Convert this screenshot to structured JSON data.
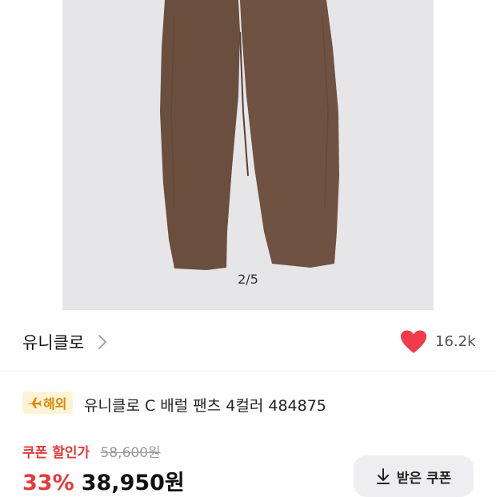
{
  "image": {
    "counter": "2/5",
    "product_color": "#6b4f3e",
    "background": "#e6e6e8"
  },
  "brand": {
    "name": "유니클로",
    "chevron_icon": "chevron-right-icon",
    "heart_icon": "heart-icon",
    "heart_color": "#ef3b4a",
    "like_count": "16.2k"
  },
  "product": {
    "badge_icon": "airplane-icon",
    "badge_label": "해외",
    "title": "유니클로 C 배럴 팬츠 4컬러 484875"
  },
  "price": {
    "coupon_label": "쿠폰 할인가",
    "original": "58,600원",
    "discount": "33%",
    "sale": "38,950원",
    "accent_color": "#e23b3b"
  },
  "coupon_button": {
    "icon": "download-icon",
    "label": "받은 쿠폰"
  }
}
